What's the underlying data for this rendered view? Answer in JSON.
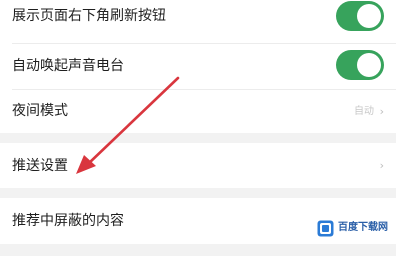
{
  "settings": {
    "rows": [
      {
        "label": "展示页面右下角刷新按钮",
        "control": "toggle",
        "on": true
      },
      {
        "label": "自动唤起声音电台",
        "control": "toggle",
        "on": true
      },
      {
        "label": "夜间模式",
        "control": "value",
        "value": "自动",
        "chevron": "›"
      },
      {
        "label": "推送设置",
        "control": "chevron",
        "chevron": "›"
      },
      {
        "label": "推荐中屏蔽的内容",
        "control": "none"
      }
    ]
  },
  "annotation": {
    "arrow_color": "#d9363e"
  },
  "watermark": {
    "text": "百度下载网",
    "logo_icon": "download-site-logo-icon"
  },
  "colors": {
    "toggle_on": "#37a35c",
    "background": "#f2f2f2",
    "row_bg": "#ffffff"
  }
}
